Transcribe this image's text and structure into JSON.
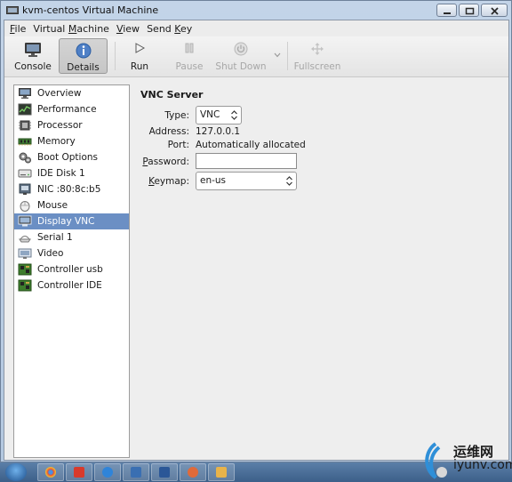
{
  "window": {
    "title": "kvm-centos Virtual Machine"
  },
  "menu": {
    "items": [
      "File",
      "Virtual Machine",
      "View",
      "Send Key"
    ]
  },
  "toolbar": {
    "console": "Console",
    "details": "Details",
    "run": "Run",
    "pause": "Pause",
    "shutdown": "Shut Down",
    "fullscreen": "Fullscreen"
  },
  "sidebar": {
    "items": [
      {
        "label": "Overview",
        "icon": "monitor-icon"
      },
      {
        "label": "Performance",
        "icon": "performance-graph-icon"
      },
      {
        "label": "Processor",
        "icon": "cpu-chip-icon"
      },
      {
        "label": "Memory",
        "icon": "memory-module-icon"
      },
      {
        "label": "Boot Options",
        "icon": "gears-icon"
      },
      {
        "label": "IDE Disk 1",
        "icon": "hard-disk-icon"
      },
      {
        "label": "NIC :80:8c:b5",
        "icon": "network-card-icon"
      },
      {
        "label": "Mouse",
        "icon": "mouse-icon"
      },
      {
        "label": "Display VNC",
        "icon": "display-icon"
      },
      {
        "label": "Serial 1",
        "icon": "serial-port-icon"
      },
      {
        "label": "Video",
        "icon": "video-card-icon"
      },
      {
        "label": "Controller usb",
        "icon": "controller-board-icon"
      },
      {
        "label": "Controller IDE",
        "icon": "controller-board-icon"
      }
    ],
    "selected": "Display VNC"
  },
  "vnc": {
    "section_title": "VNC Server",
    "type_label": "Type:",
    "type_value": "VNC",
    "address_label": "Address:",
    "address_value": "127.0.0.1",
    "port_label": "Port:",
    "port_value": "Automatically allocated",
    "password_label_pre": "P",
    "password_label_post": "assword:",
    "password_value": "",
    "keymap_label_pre": "K",
    "keymap_label_post": "eymap:",
    "keymap_value": "en-us"
  },
  "watermark": {
    "line1": "运维网",
    "line2": "iyunv.com"
  },
  "colors": {
    "selection": "#6b8fc4",
    "titlebar": "#b4c8e0",
    "taskbar": "#3c5f89"
  }
}
